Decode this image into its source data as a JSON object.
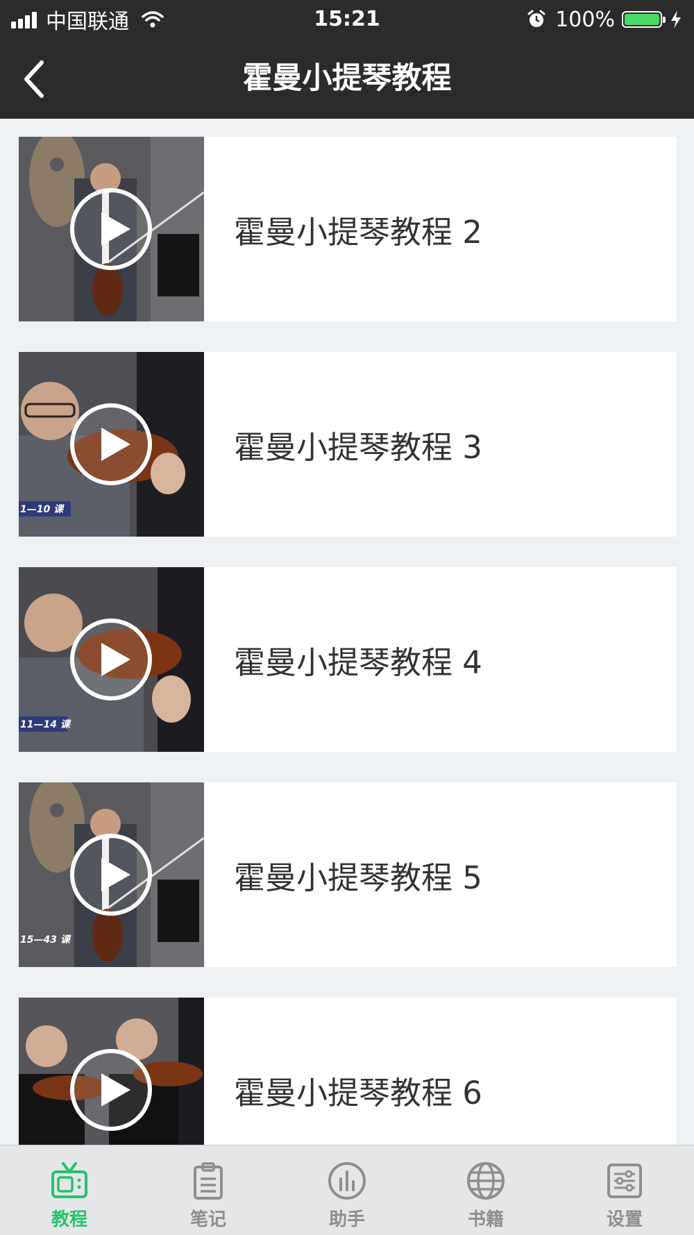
{
  "status_bar": {
    "carrier": "中国联通",
    "time": "15:21",
    "battery": "100%",
    "icons": [
      "signal-icon",
      "wifi-icon",
      "alarm-icon",
      "battery-icon",
      "charging-icon"
    ]
  },
  "nav": {
    "title": "霍曼小提琴教程",
    "back_icon": "chevron-left-icon"
  },
  "videos": [
    {
      "title": "霍曼小提琴教程 2"
    },
    {
      "title": "霍曼小提琴教程 3",
      "badge": "1—10 课"
    },
    {
      "title": "霍曼小提琴教程 4",
      "badge": "11—14 课"
    },
    {
      "title": "霍曼小提琴教程 5",
      "badge": "15—43 课"
    },
    {
      "title": "霍曼小提琴教程 6"
    }
  ],
  "tabbar": {
    "active_color": "#27c26a",
    "inactive_color": "#8e8e8e",
    "tabs": [
      {
        "label": "教程",
        "icon": "tv-icon",
        "active": true
      },
      {
        "label": "笔记",
        "icon": "clipboard-icon",
        "active": false
      },
      {
        "label": "助手",
        "icon": "bar-chart-icon",
        "active": false
      },
      {
        "label": "书籍",
        "icon": "globe-icon",
        "active": false
      },
      {
        "label": "设置",
        "icon": "sliders-icon",
        "active": false
      }
    ]
  }
}
